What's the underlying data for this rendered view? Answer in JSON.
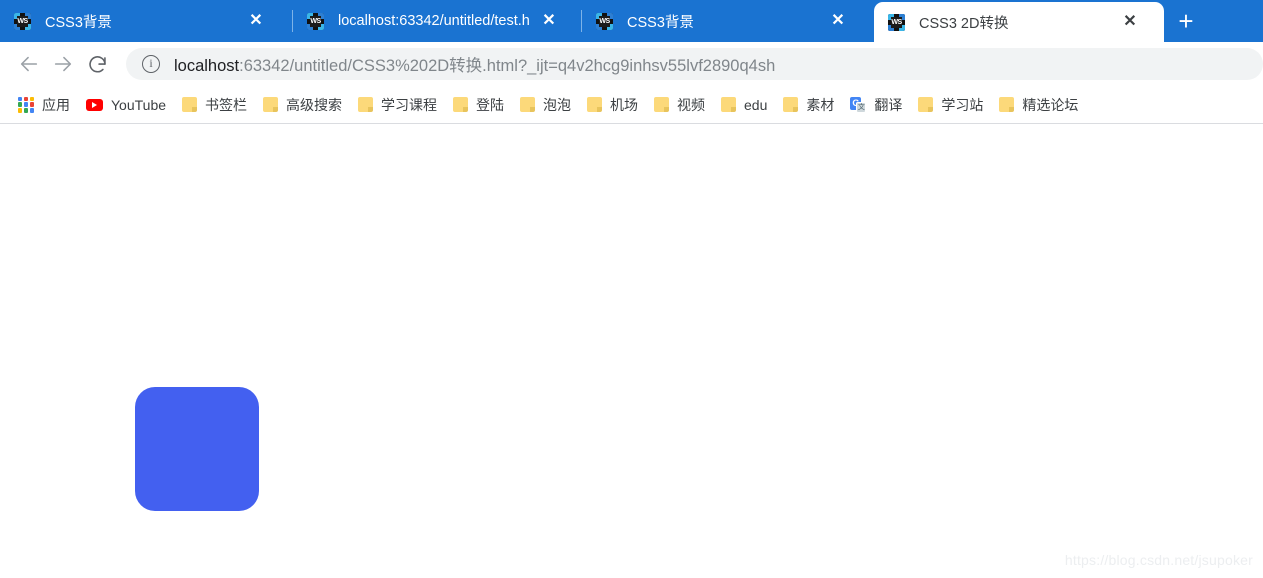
{
  "browser": {
    "tabs": [
      {
        "title": "CSS3背景",
        "favicon": "webstorm-icon",
        "active": false,
        "close_label": "✕"
      },
      {
        "title": "localhost:63342/untitled/test.h",
        "favicon": "webstorm-icon",
        "active": false,
        "close_label": "✕"
      },
      {
        "title": "CSS3背景",
        "favicon": "webstorm-icon",
        "active": false,
        "close_label": "✕"
      },
      {
        "title": "CSS3 2D转换",
        "favicon": "webstorm-icon",
        "active": true,
        "close_label": "✕"
      }
    ],
    "new_tab_label": "+",
    "toolbar": {
      "back_icon": "back-arrow-icon",
      "forward_icon": "forward-arrow-icon",
      "reload_icon": "reload-icon",
      "site_info_icon": "info-icon",
      "site_info_glyph": "i",
      "url_host": "localhost",
      "url_rest": ":63342/untitled/CSS3%202D转换.html?_ijt=q4v2hcg9inhsv55lvf2890q4sh",
      "url_full": "localhost:63342/untitled/CSS3%202D转换.html?_ijt=q4v2hcg9inhsv55lvf2890q4sh"
    },
    "bookmarks": [
      {
        "label": "应用",
        "icon": "apps-grid-icon"
      },
      {
        "label": "YouTube",
        "icon": "youtube-icon"
      },
      {
        "label": "书签栏",
        "icon": "folder-icon"
      },
      {
        "label": "高级搜索",
        "icon": "folder-icon"
      },
      {
        "label": "学习课程",
        "icon": "folder-icon"
      },
      {
        "label": "登陆",
        "icon": "folder-icon"
      },
      {
        "label": "泡泡",
        "icon": "folder-icon"
      },
      {
        "label": "机场",
        "icon": "folder-icon"
      },
      {
        "label": "视频",
        "icon": "folder-icon"
      },
      {
        "label": "edu",
        "icon": "folder-icon"
      },
      {
        "label": "素材",
        "icon": "folder-icon"
      },
      {
        "label": "翻译",
        "icon": "google-translate-icon"
      },
      {
        "label": "学习站",
        "icon": "folder-icon"
      },
      {
        "label": "精选论坛",
        "icon": "folder-icon"
      }
    ]
  },
  "page": {
    "demo_box_color": "#4360f0",
    "watermark": "https://blog.csdn.net/jsupoker"
  },
  "colors": {
    "tabstrip_blue": "#1a73d1",
    "omnibox_bg": "#f1f3f4",
    "demo_blue": "#4360f0"
  }
}
